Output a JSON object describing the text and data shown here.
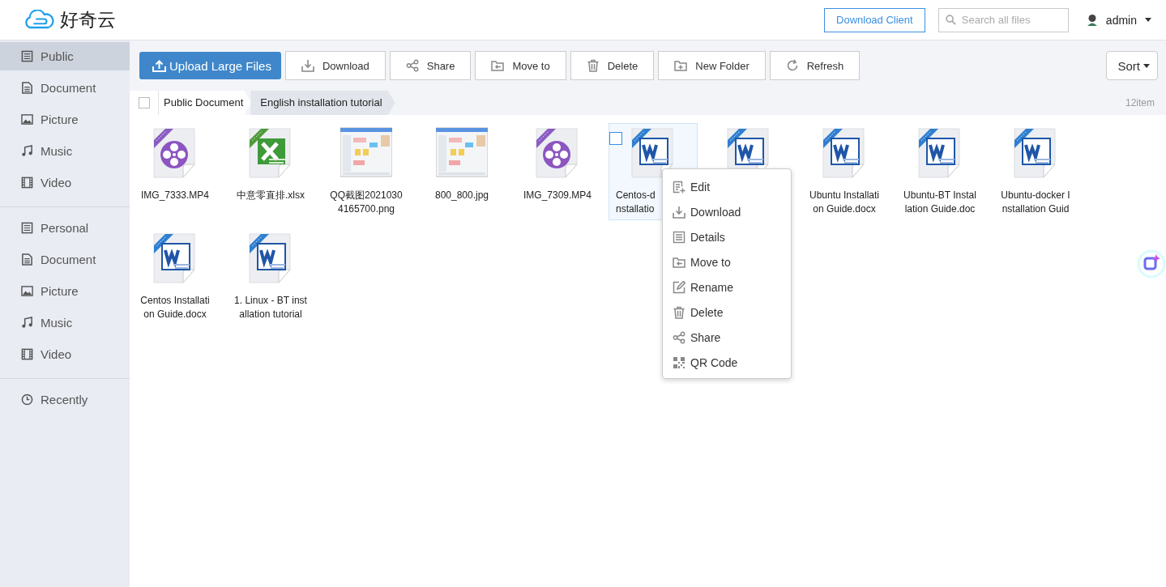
{
  "header": {
    "logo_text": "好奇云",
    "download_client": "Download Client",
    "search": {
      "placeholder": "Search all files"
    },
    "user": "admin"
  },
  "sidebar": {
    "groups": [
      {
        "items": [
          {
            "label": "Public",
            "selected": true
          },
          {
            "label": "Document",
            "selected": false
          },
          {
            "label": "Picture",
            "selected": false
          },
          {
            "label": "Music",
            "selected": false
          },
          {
            "label": "Video",
            "selected": false
          }
        ]
      },
      {
        "items": [
          {
            "label": "Personal",
            "selected": false
          },
          {
            "label": "Document",
            "selected": false
          },
          {
            "label": "Picture",
            "selected": false
          },
          {
            "label": "Music",
            "selected": false
          },
          {
            "label": "Video",
            "selected": false
          }
        ]
      },
      {
        "items": [
          {
            "label": "Recently",
            "selected": false
          }
        ]
      }
    ]
  },
  "toolbar": {
    "upload": "Upload Large Files",
    "buttons": [
      "Download",
      "Share",
      "Move to",
      "Delete",
      "New Folder",
      "Refresh"
    ],
    "sort": "Sort"
  },
  "breadcrumb": {
    "checked": false,
    "items": [
      {
        "label": "Public Document",
        "current": false
      },
      {
        "label": "English installation tutorial",
        "current": true
      }
    ],
    "count": "12item"
  },
  "files": [
    {
      "kind": "video",
      "name_lines": [
        "IMG_7333.MP4"
      ],
      "selected": false
    },
    {
      "kind": "excel",
      "name_lines": [
        "中意零直排.xlsx"
      ],
      "selected": false
    },
    {
      "kind": "picture",
      "name_lines": [
        "QQ截图2021030",
        "4165700.png"
      ],
      "selected": false
    },
    {
      "kind": "picture",
      "name_lines": [
        "800_800.jpg"
      ],
      "selected": false
    },
    {
      "kind": "video",
      "name_lines": [
        "IMG_7309.MP4"
      ],
      "selected": false
    },
    {
      "kind": "word",
      "name_lines": [
        "Centos-d",
        "nstallatio"
      ],
      "selected": true
    },
    {
      "kind": "word",
      "selected": false
    },
    {
      "kind": "word",
      "name_lines": [
        "Ubuntu Installati",
        "on Guide.docx"
      ],
      "selected": false
    },
    {
      "kind": "word",
      "name_lines": [
        "Ubuntu-BT Instal",
        "lation Guide.doc"
      ],
      "selected": false
    },
    {
      "kind": "word",
      "name_lines": [
        "Ubuntu-docker I",
        "nstallation Guid"
      ],
      "selected": false
    },
    {
      "kind": "word",
      "name_lines": [
        "Centos Installati",
        "on Guide.docx"
      ],
      "selected": false
    },
    {
      "kind": "word",
      "name_lines": [
        "1. Linux - BT inst",
        "allation tutorial"
      ],
      "selected": false
    }
  ],
  "context_menu": [
    "Edit",
    "Download",
    "Details",
    "Move to",
    "Rename",
    "Delete",
    "Share",
    "QR Code"
  ]
}
